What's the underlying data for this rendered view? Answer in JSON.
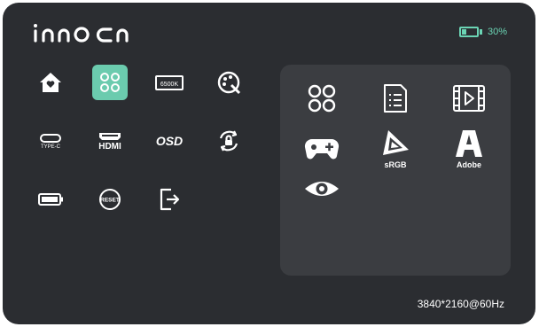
{
  "brand": {
    "logo_text": "innocn"
  },
  "status": {
    "battery_percent": "30%",
    "battery_level": 0.3,
    "accent_color": "#6bd4b4"
  },
  "menu": {
    "items": [
      {
        "name": "home-icon"
      },
      {
        "name": "grid-mode-icon",
        "selected": true
      },
      {
        "name": "color-temp-icon",
        "label": "6500K"
      },
      {
        "name": "palette-icon"
      },
      {
        "name": "usb-c-icon",
        "label": "TYPE-C"
      },
      {
        "name": "hdmi-icon",
        "label": "HDMI"
      },
      {
        "name": "osd-icon",
        "label": "OSD"
      },
      {
        "name": "lock-rotate-icon"
      },
      {
        "name": "battery-icon"
      },
      {
        "name": "reset-icon",
        "label": "RESET"
      },
      {
        "name": "exit-icon"
      }
    ]
  },
  "submenu": {
    "items": [
      {
        "name": "standard-mode-icon"
      },
      {
        "name": "document-mode-icon"
      },
      {
        "name": "movie-mode-icon"
      },
      {
        "name": "game-mode-icon"
      },
      {
        "name": "srgb-mode-icon",
        "label": "sRGB"
      },
      {
        "name": "adobe-mode-icon",
        "label": "Adobe"
      },
      {
        "name": "eye-care-icon"
      }
    ]
  },
  "footer": {
    "resolution": "3840*2160@60Hz"
  }
}
